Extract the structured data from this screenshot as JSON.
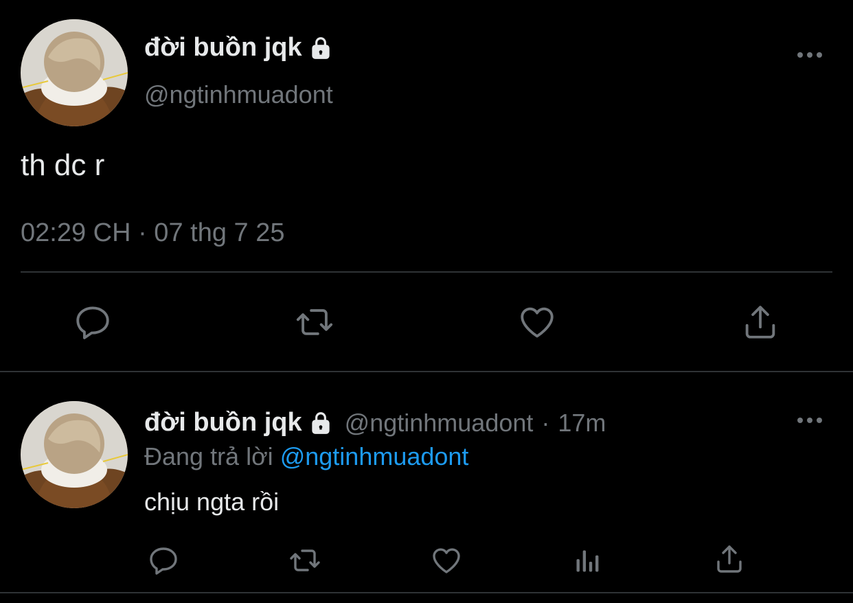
{
  "main_tweet": {
    "display_name": "đời buồn jqk",
    "handle": "@ngtinhmuadont",
    "text": "th dc r",
    "timestamp": "02:29 CH · 07 thg 7 25",
    "icons": {
      "lock": "lock-icon",
      "more": "more-horizontal-icon",
      "reply": "reply-icon",
      "retweet": "retweet-icon",
      "like": "heart-icon",
      "share": "share-icon"
    }
  },
  "reply_tweet": {
    "display_name": "đời buồn jqk",
    "handle": "@ngtinhmuadont",
    "separator": "·",
    "age": "17m",
    "replying_to_prefix": "Đang trả lời",
    "replying_to_handle": "@ngtinhmuadont",
    "text": "chịu ngta rồi",
    "icons": {
      "lock": "lock-icon",
      "more": "more-horizontal-icon",
      "reply": "reply-icon",
      "retweet": "retweet-icon",
      "like": "heart-icon",
      "views": "analytics-icon",
      "share": "share-icon"
    }
  },
  "colors": {
    "background": "#000000",
    "text_primary": "#e7e9ea",
    "text_secondary": "#71767b",
    "link": "#1d9bf0",
    "divider": "#2f3336"
  }
}
